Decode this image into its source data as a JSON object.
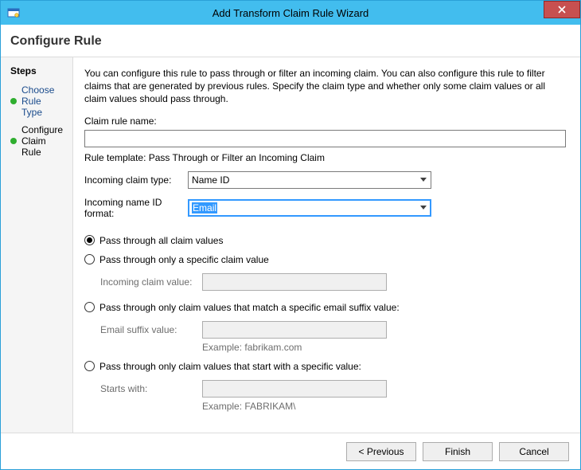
{
  "window": {
    "title": "Add Transform Claim Rule Wizard"
  },
  "header": "Configure Rule",
  "sidebar": {
    "heading": "Steps",
    "steps": [
      {
        "label": "Choose Rule Type",
        "current": false
      },
      {
        "label": "Configure Claim Rule",
        "current": true
      }
    ]
  },
  "content": {
    "description": "You can configure this rule to pass through or filter an incoming claim. You can also configure this rule to filter claims that are generated by previous rules. Specify the claim type and whether only some claim values or all claim values should pass through.",
    "ruleNameLabel": "Claim rule name:",
    "ruleNameValue": "",
    "templateLine": "Rule template: Pass Through or Filter an Incoming Claim",
    "incomingTypeLabel": "Incoming claim type:",
    "incomingTypeValue": "Name ID",
    "incomingFormatLabel": "Incoming name ID format:",
    "incomingFormatValue": "Email",
    "radios": {
      "opt1": "Pass through all claim values",
      "opt2": "Pass through only a specific claim value",
      "opt2SubLabel": "Incoming claim value:",
      "opt3": "Pass through only claim values that match a specific email suffix value:",
      "opt3SubLabel": "Email suffix value:",
      "opt3Example": "Example: fabrikam.com",
      "opt4": "Pass through only claim values that start with a specific value:",
      "opt4SubLabel": "Starts with:",
      "opt4Example": "Example: FABRIKAM\\",
      "selectedIndex": 0
    }
  },
  "buttons": {
    "previous": "< Previous",
    "finish": "Finish",
    "cancel": "Cancel"
  }
}
